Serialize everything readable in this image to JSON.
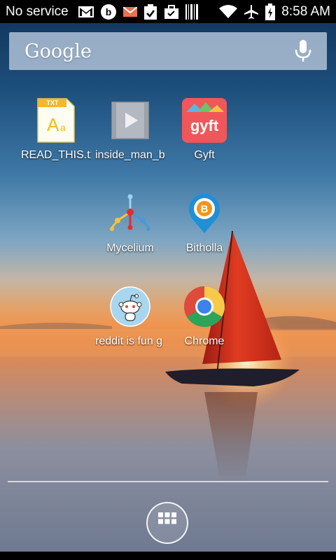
{
  "statusbar": {
    "carrier": "No service",
    "time": "8:58 AM",
    "icons": [
      "gmail-icon",
      "beats-icon",
      "email-icon",
      "clipboard-icon",
      "briefcase-icon",
      "barcode-icon",
      "wifi-icon",
      "airplane-icon",
      "battery-icon"
    ]
  },
  "search": {
    "logo": "Google",
    "mic_icon": "microphone-icon"
  },
  "apps": [
    {
      "label": "READ_THIS.txt",
      "icon": "txt-file-icon"
    },
    {
      "label": "inside_man_b",
      "icon": "video-file-icon"
    },
    {
      "label": "Gyft",
      "icon": "gyft-icon"
    },
    {
      "label": "Mycelium",
      "icon": "mycelium-icon"
    },
    {
      "label": "Bitholla",
      "icon": "bitholla-icon"
    },
    {
      "label": "reddit is fun g",
      "icon": "reddit-icon"
    },
    {
      "label": "Chrome",
      "icon": "chrome-icon"
    }
  ],
  "dock": {
    "all_apps_icon": "app-drawer-icon"
  },
  "colors": {
    "sail": "#d8331f",
    "statusbar": "#000000"
  }
}
